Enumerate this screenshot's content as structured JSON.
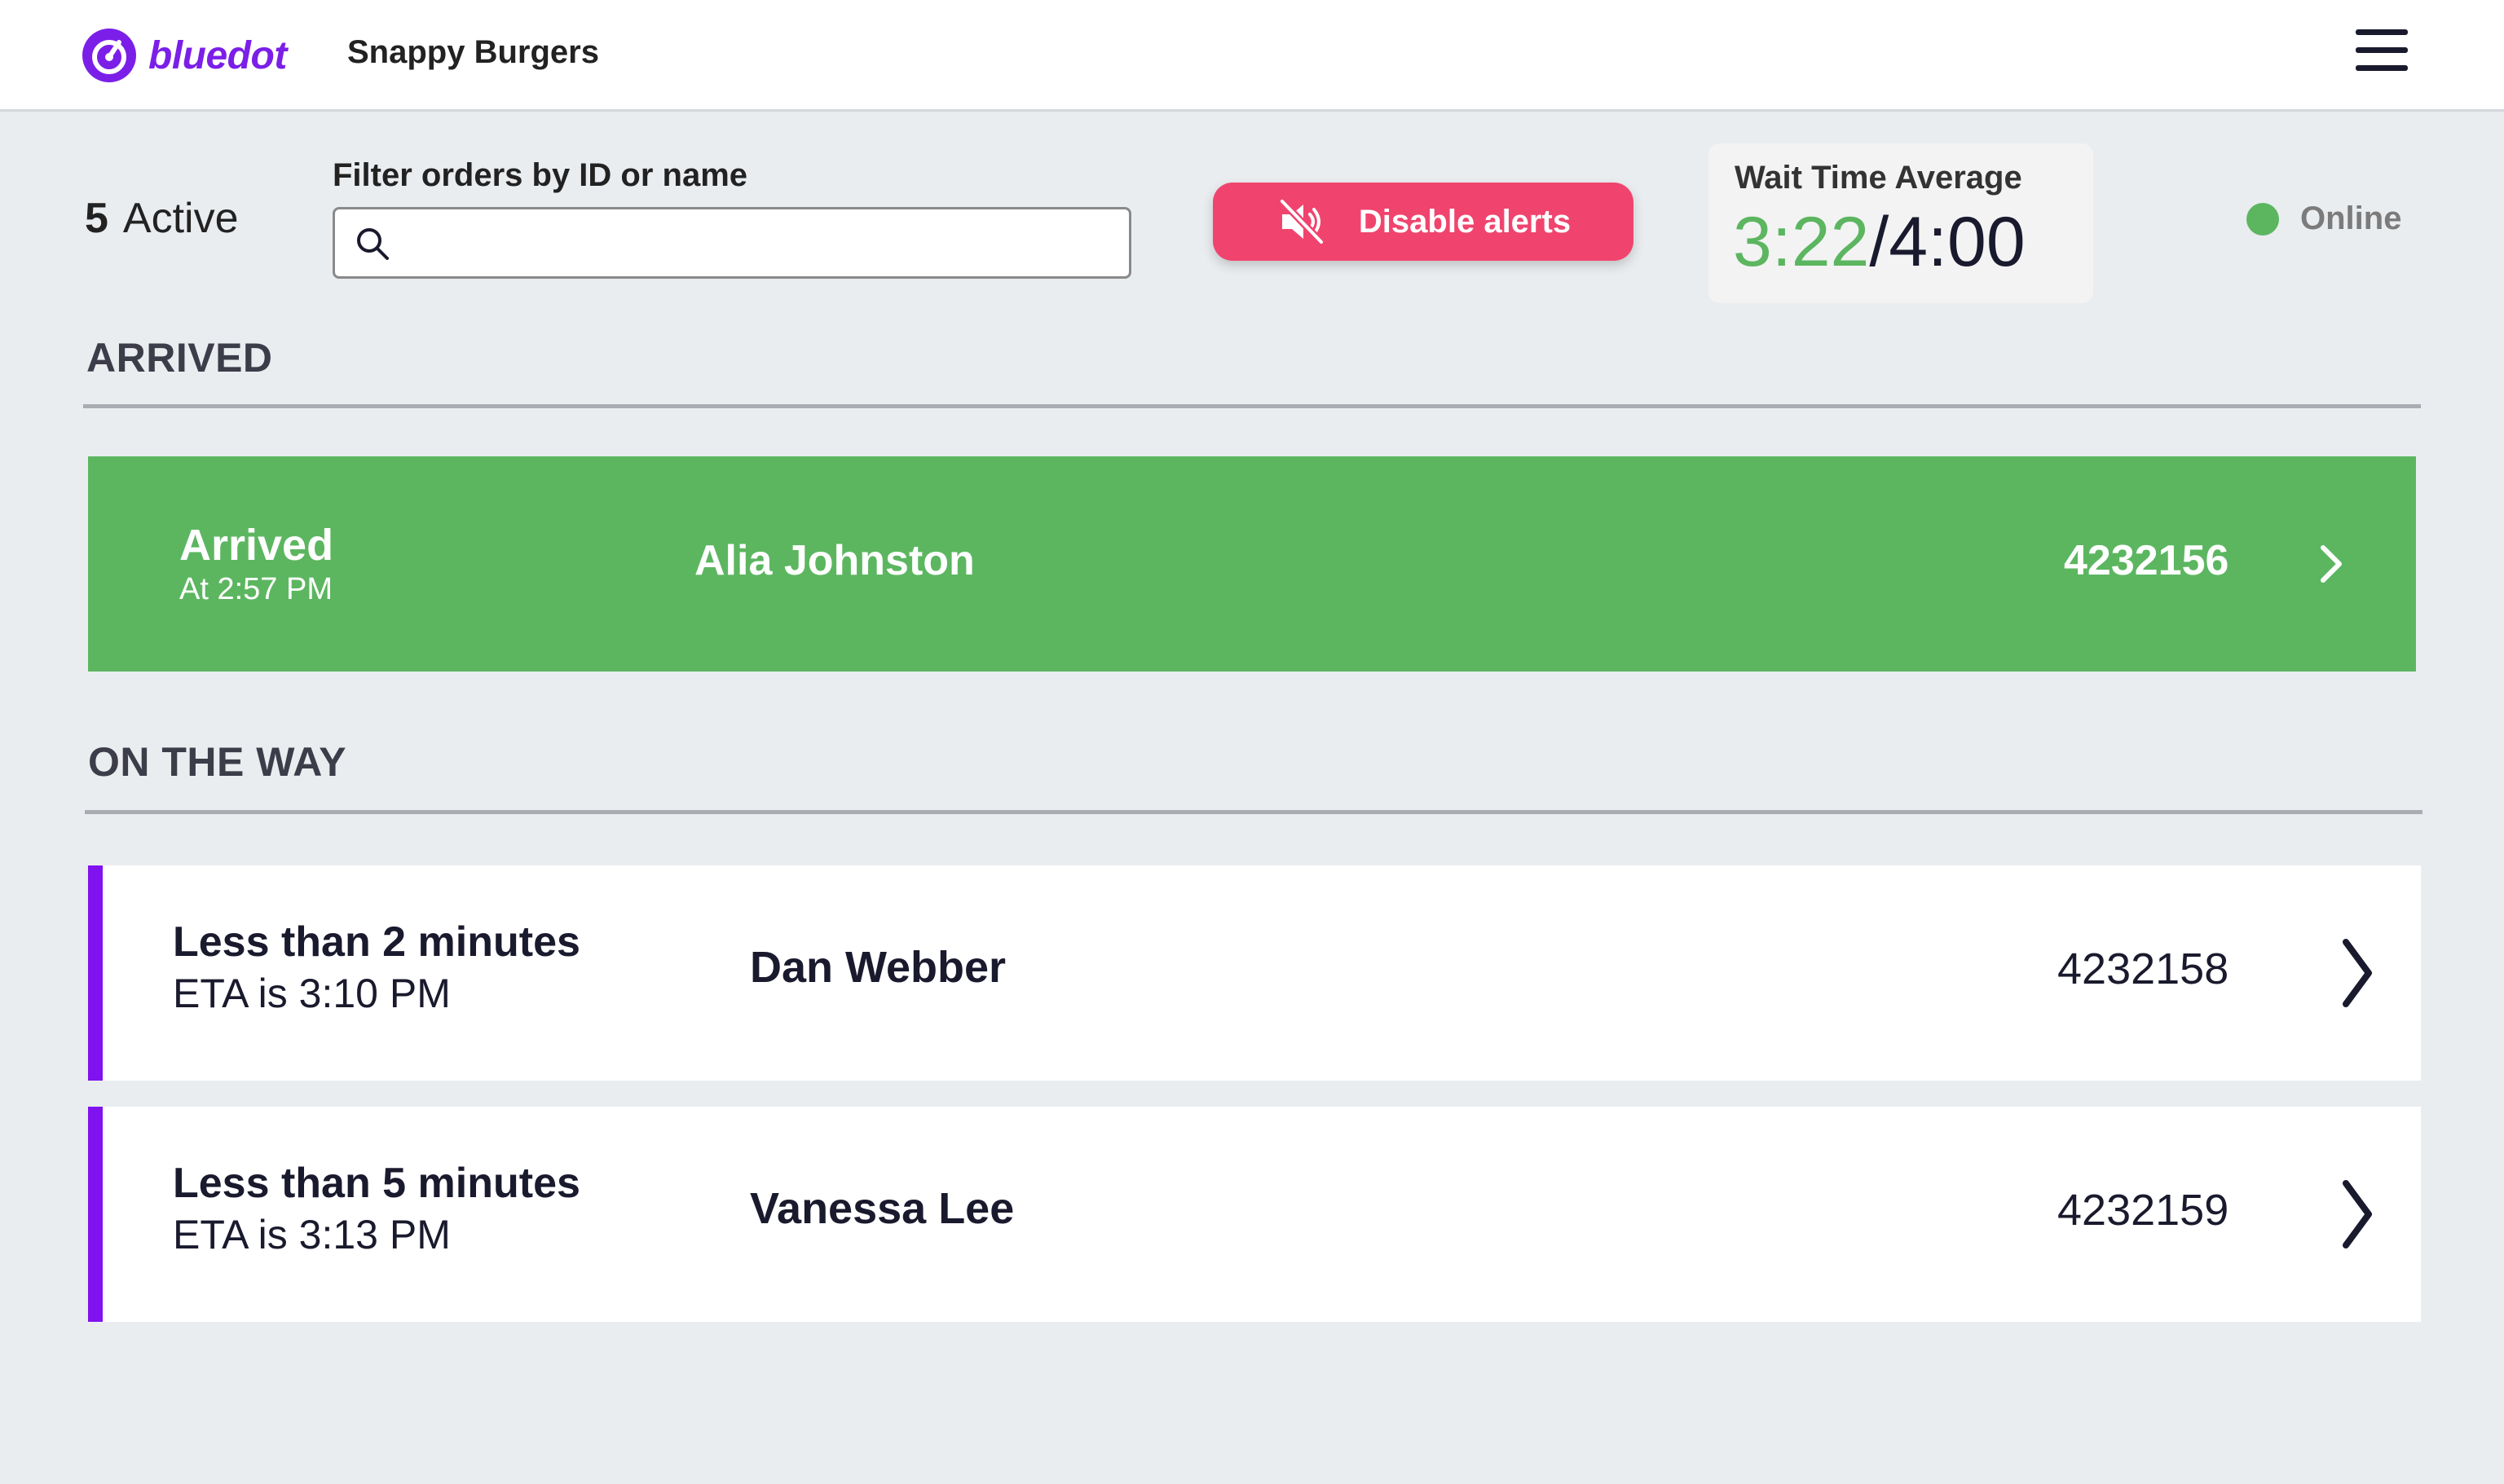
{
  "header": {
    "brand": "bluedot",
    "shop_name": "Snappy Burgers",
    "menu_icon": "hamburger-menu-icon"
  },
  "toolbar": {
    "active_count": "5",
    "active_label": "Active",
    "filter_label": "Filter orders by ID or name",
    "filter_value": "",
    "filter_placeholder": "",
    "alerts_button_label": "Disable alerts",
    "wait": {
      "title": "Wait Time Average",
      "current": "3:22",
      "separator": "/",
      "target": "4:00"
    },
    "status_label": "Online"
  },
  "sections": {
    "arrived_title": "ARRIVED",
    "on_the_way_title": "ON THE WAY"
  },
  "arrived_order": {
    "status": "Arrived",
    "time": "At 2:57 PM",
    "name": "Alia Johnston",
    "id": "4232156"
  },
  "on_the_way_orders": [
    {
      "eta_title": "Less than 2 minutes",
      "eta_time": "ETA is 3:10 PM",
      "name": "Dan Webber",
      "id": "4232158"
    },
    {
      "eta_title": "Less than 5 minutes",
      "eta_time": "ETA is 3:13 PM",
      "name": "Vanessa Lee",
      "id": "4232159"
    }
  ],
  "colors": {
    "brand": "#7b1fe8",
    "arrived_green": "#5cb660",
    "alert_pink": "#f0446e",
    "eta_bar_purple": "#8012ef",
    "background": "#eaedf0"
  }
}
